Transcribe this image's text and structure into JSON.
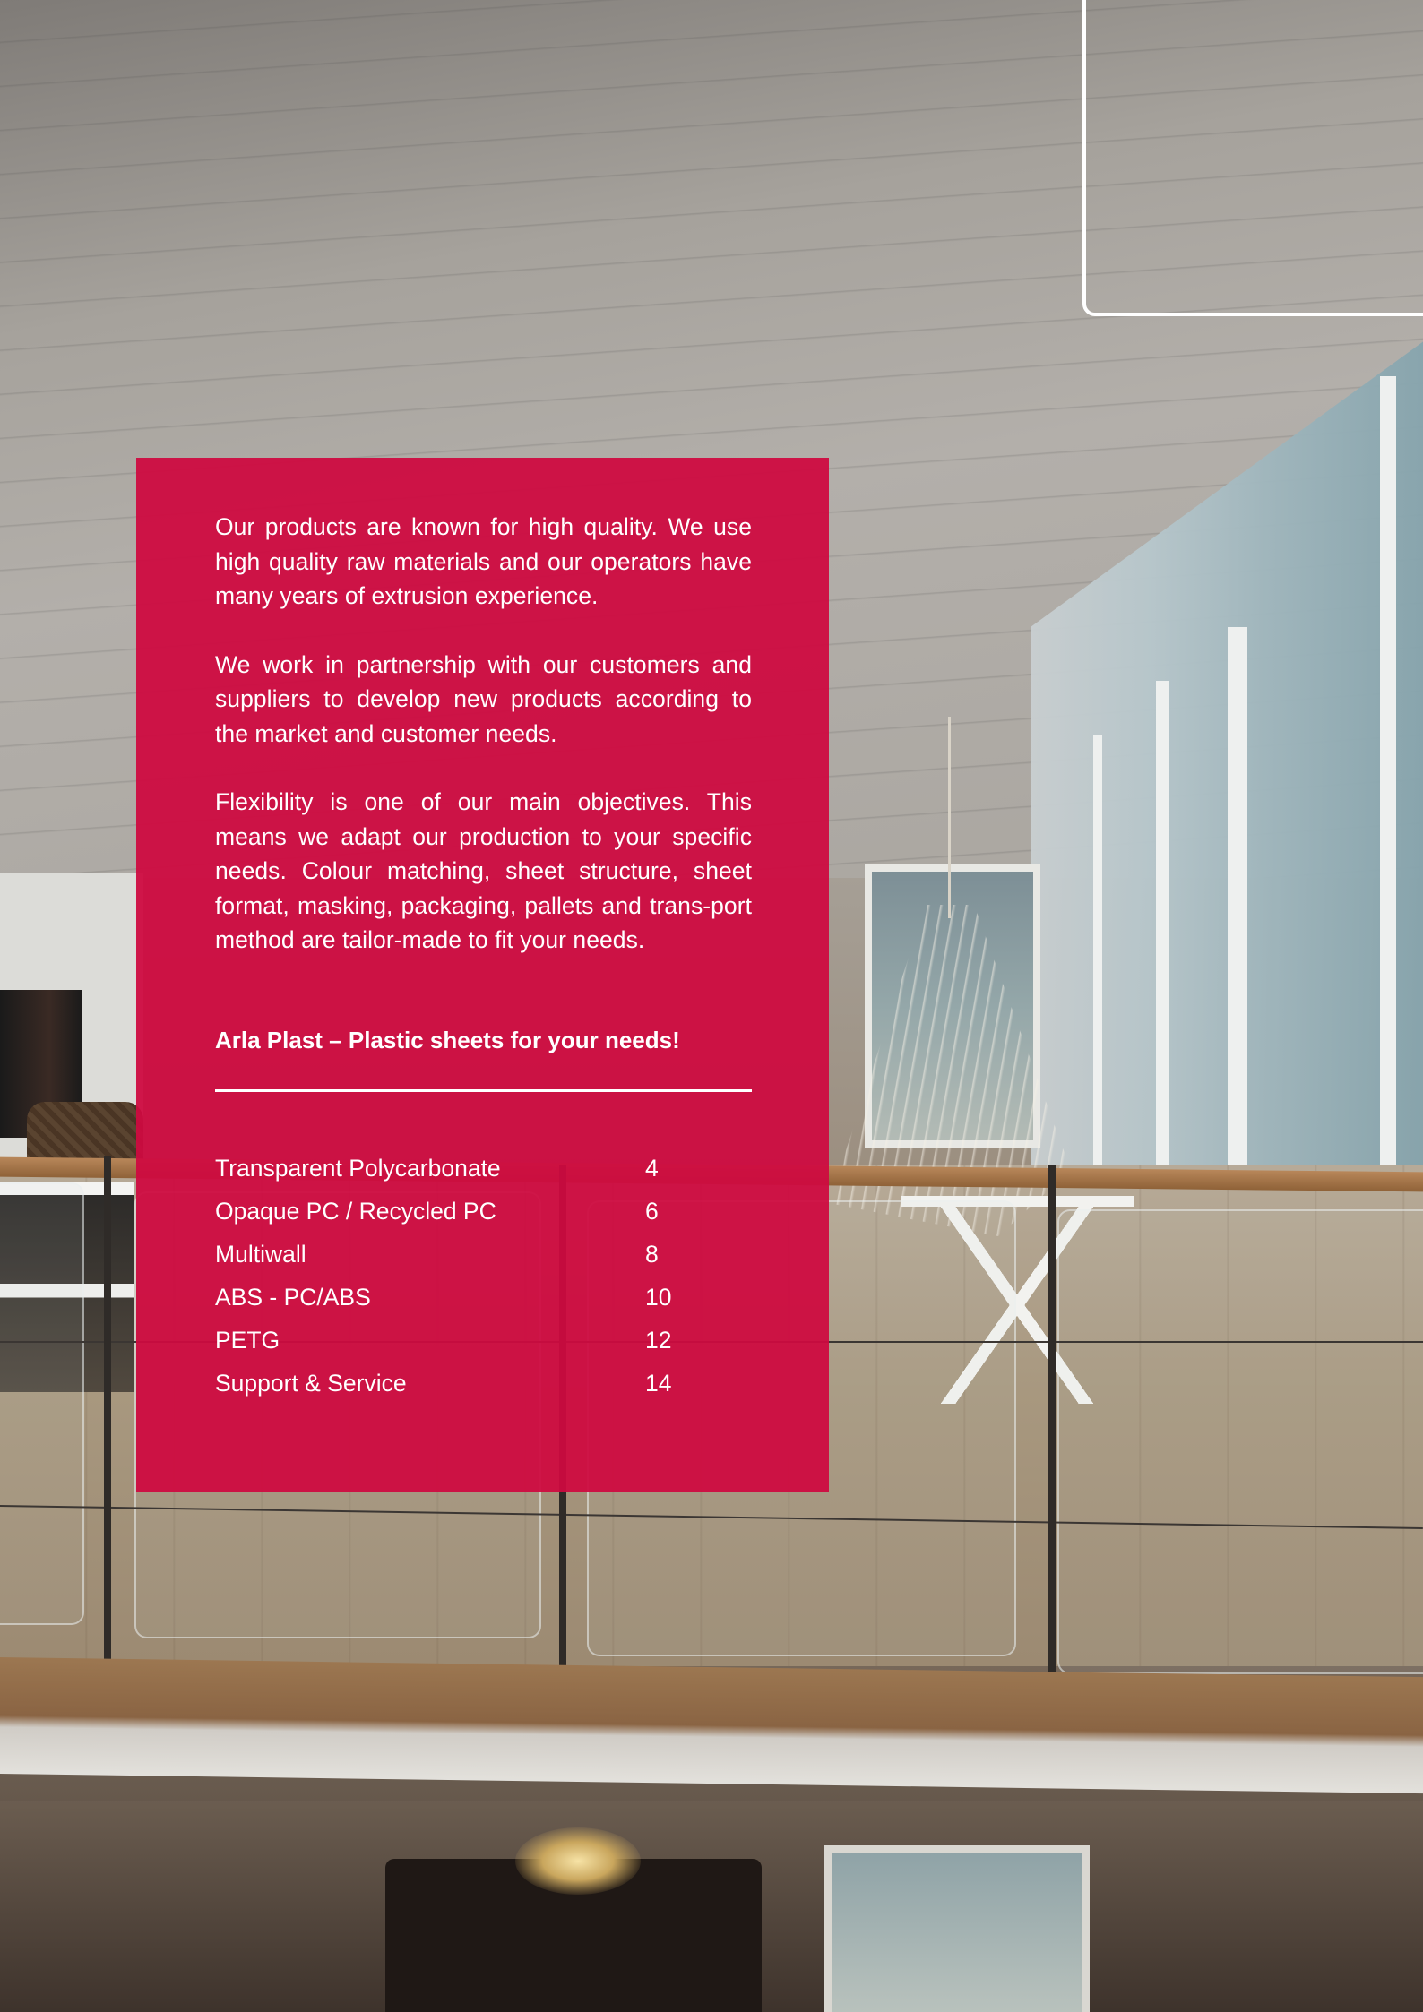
{
  "panel": {
    "paragraphs": [
      "Our products are known for high quality. We use high quality raw materials and our operators have many years of extrusion experience.",
      "We work in partnership with our customers and suppliers to develop new products according to the market and customer needs.",
      "Flexibility is one of our main objectives. This means we adapt our production to your specific needs. Colour matching, sheet structure, sheet format, masking, packaging, pallets and trans-port method are tailor-made to fit your needs."
    ],
    "tagline": "Arla Plast – Plastic sheets for your needs!",
    "toc": [
      {
        "label": "Transparent Polycarbonate",
        "page": "4"
      },
      {
        "label": "Opaque PC / Recycled PC",
        "page": "6"
      },
      {
        "label": "Multiwall",
        "page": "8"
      },
      {
        "label": "ABS - PC/ABS",
        "page": "10"
      },
      {
        "label": "PETG",
        "page": "12"
      },
      {
        "label": "Support & Service",
        "page": "14"
      }
    ]
  },
  "colors": {
    "panel_background": "#ce0a40",
    "text": "#ffffff",
    "frame_stroke": "#ffffff"
  }
}
